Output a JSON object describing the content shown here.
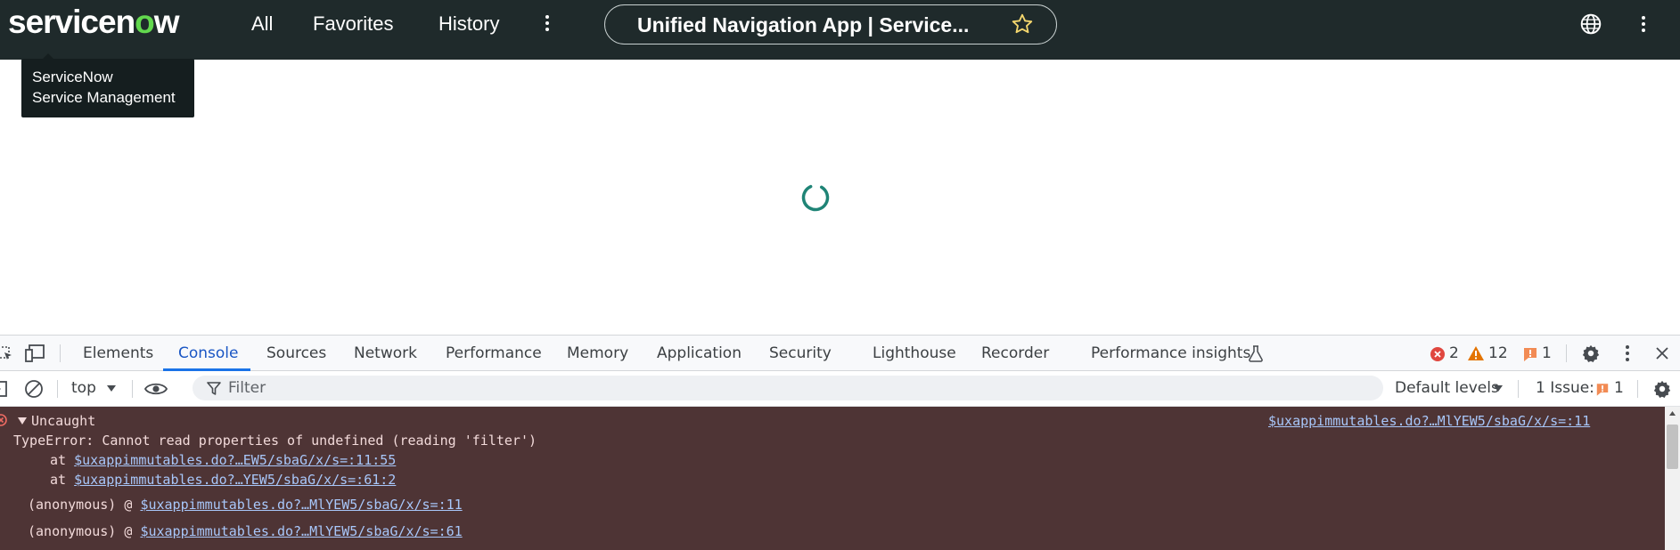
{
  "header": {
    "logo": {
      "before": "servicen",
      "o": "o",
      "after": "w"
    },
    "nav": [
      "All",
      "Favorites",
      "History"
    ],
    "page_title": "Unified Navigation App | Service...",
    "tooltip": {
      "line1": "ServiceNow",
      "line2": "Service Management"
    }
  },
  "devtools": {
    "tabs": [
      "Elements",
      "Console",
      "Sources",
      "Network",
      "Performance",
      "Memory",
      "Application",
      "Security",
      "Lighthouse",
      "Recorder",
      "Performance insights"
    ],
    "active_tab": "Console",
    "errors": "2",
    "warnings": "12",
    "issues_badge": "1",
    "context": "top",
    "filter_placeholder": "Filter",
    "levels": "Default levels",
    "issues_label": "1 Issue:",
    "issues_count": "1",
    "console": {
      "uncaught": "Uncaught",
      "source_link": "$uxappimmutables.do?…MlYEW5/sbaG/x/s=:11",
      "error": "TypeError: Cannot read properties of undefined (reading 'filter')",
      "stack": [
        {
          "prefix": "at ",
          "link": "$uxappimmutables.do?…EW5/sbaG/x/s=:11:55"
        },
        {
          "prefix": "at ",
          "link": "$uxappimmutables.do?…YEW5/sbaG/x/s=:61:2"
        }
      ],
      "calls": [
        {
          "prefix": "(anonymous) @ ",
          "link": "$uxappimmutables.do?…MlYEW5/sbaG/x/s=:11"
        },
        {
          "prefix": "(anonymous) @ ",
          "link": "$uxappimmutables.do?…MlYEW5/sbaG/x/s=:61"
        }
      ]
    }
  },
  "colors": {
    "header_bg": "#1f2a2b",
    "accent_green": "#62d84e",
    "spinner": "#1f8476",
    "console_error_bg": "#4e3435",
    "link": "#a8c7fa"
  }
}
